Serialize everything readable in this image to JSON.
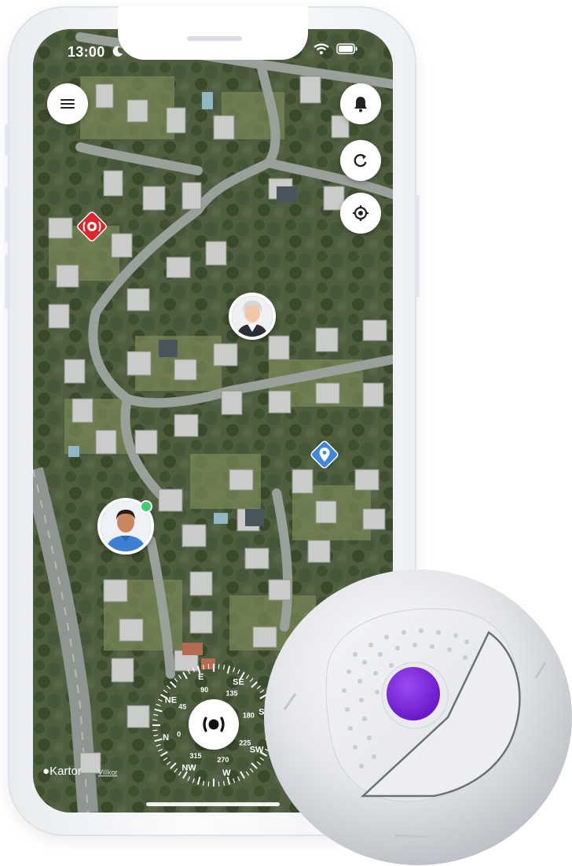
{
  "status": {
    "time": "13:00"
  },
  "map": {
    "attribution": "Kartor",
    "terms_link": "Villkor"
  },
  "compass": {
    "cardinals": [
      "N",
      "NE",
      "E",
      "SE",
      "S",
      "SW",
      "W",
      "NW"
    ],
    "degrees": [
      "0",
      "45",
      "90",
      "135",
      "180",
      "225",
      "270",
      "315"
    ]
  },
  "colors": {
    "alarm_marker": "#e0262d",
    "location_marker": "#3f86e0",
    "device_button": "#7a26d4",
    "online": "#3fcf6a"
  },
  "icons": [
    "menu-icon",
    "bell-icon",
    "refresh-icon",
    "crosshair-icon",
    "alarm-icon",
    "pin-icon",
    "alarm-button-icon"
  ]
}
